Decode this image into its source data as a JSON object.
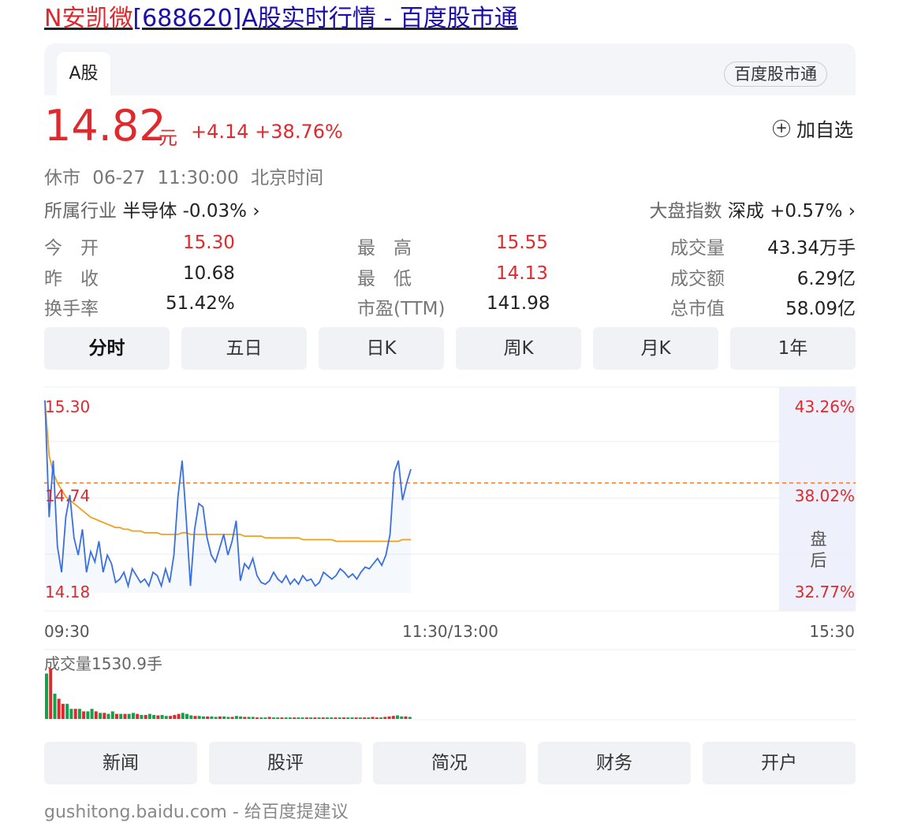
{
  "page_title": {
    "highlight": "N安凯微",
    "rest": "[688620]A股实时行情 - 百度股市通"
  },
  "tab": "A股",
  "badge": "百度股市通",
  "quote": {
    "price": "14.82",
    "unit": "元",
    "change": "+4.14 +38.76%",
    "add_label": "加自选",
    "status": "休市  06-27 11:30:00  北京时间",
    "industry_label": "所属行业",
    "industry_value": "半导体 -0.03%",
    "index_label": "大盘指数",
    "index_value": "深成 +0.57%"
  },
  "stats": [
    {
      "label": "今　开",
      "value": "15.30",
      "color": "red"
    },
    {
      "label": "最　高",
      "value": "15.55",
      "color": "red"
    },
    {
      "label": "成交量",
      "value": "43.34万手",
      "color": "black"
    },
    {
      "label": "昨　收",
      "value": "10.68",
      "color": "black"
    },
    {
      "label": "最　低",
      "value": "14.13",
      "color": "red"
    },
    {
      "label": "成交额",
      "value": "6.29亿",
      "color": "black"
    },
    {
      "label": "换手率",
      "value": "51.42%",
      "color": "black"
    },
    {
      "label": "市盈(TTM)",
      "value": "141.98",
      "color": "black"
    },
    {
      "label": "总市值",
      "value": "58.09亿",
      "color": "black"
    }
  ],
  "periods": [
    "分时",
    "五日",
    "日K",
    "周K",
    "月K",
    "1年"
  ],
  "chart_data": {
    "type": "line",
    "y_labels": [
      "15.30",
      "14.74",
      "14.18"
    ],
    "pct_labels": [
      "43.26%",
      "38.02%",
      "32.77%"
    ],
    "time_labels": [
      "09:30",
      "11:30/13:00",
      "15:30"
    ],
    "after_hours_label": [
      "盘",
      "后"
    ],
    "prev_close_ref": 14.82,
    "ylim": [
      14.18,
      15.3
    ],
    "price": [
      15.3,
      14.62,
      14.95,
      14.45,
      14.3,
      14.62,
      14.75,
      14.5,
      14.4,
      14.55,
      14.3,
      14.42,
      14.36,
      14.48,
      14.3,
      14.4,
      14.35,
      14.24,
      14.26,
      14.3,
      14.22,
      14.32,
      14.28,
      14.24,
      14.26,
      14.22,
      14.3,
      14.28,
      14.22,
      14.32,
      14.24,
      14.4,
      14.74,
      14.95,
      14.6,
      14.22,
      14.55,
      14.7,
      14.68,
      14.5,
      14.4,
      14.36,
      14.44,
      14.52,
      14.4,
      14.48,
      14.6,
      14.25,
      14.35,
      14.32,
      14.38,
      14.28,
      14.24,
      14.23,
      14.25,
      14.3,
      14.26,
      14.24,
      14.28,
      14.23,
      14.26,
      14.23,
      14.28,
      14.25,
      14.26,
      14.22,
      14.24,
      14.3,
      14.28,
      14.26,
      14.28,
      14.32,
      14.3,
      14.27,
      14.29,
      14.26,
      14.3,
      14.33,
      14.32,
      14.35,
      14.38,
      14.34,
      14.4,
      14.52,
      14.88,
      14.95,
      14.72,
      14.82,
      14.9
    ],
    "avg": [
      15.3,
      14.98,
      14.88,
      14.82,
      14.78,
      14.74,
      14.72,
      14.7,
      14.68,
      14.66,
      14.64,
      14.62,
      14.61,
      14.6,
      14.59,
      14.58,
      14.57,
      14.56,
      14.56,
      14.55,
      14.55,
      14.54,
      14.54,
      14.54,
      14.53,
      14.53,
      14.53,
      14.53,
      14.52,
      14.52,
      14.52,
      14.52,
      14.52,
      14.53,
      14.53,
      14.52,
      14.52,
      14.52,
      14.52,
      14.52,
      14.52,
      14.52,
      14.52,
      14.52,
      14.52,
      14.52,
      14.52,
      14.52,
      14.51,
      14.51,
      14.51,
      14.51,
      14.51,
      14.5,
      14.5,
      14.5,
      14.5,
      14.5,
      14.5,
      14.5,
      14.5,
      14.5,
      14.49,
      14.49,
      14.49,
      14.49,
      14.49,
      14.49,
      14.49,
      14.49,
      14.48,
      14.48,
      14.48,
      14.48,
      14.48,
      14.48,
      14.48,
      14.48,
      14.48,
      14.48,
      14.48,
      14.48,
      14.48,
      14.48,
      14.48,
      14.48,
      14.49,
      14.49,
      14.49
    ],
    "volume_label": "成交量1530.9手",
    "volume": [
      9,
      10,
      5,
      4,
      3,
      3,
      2,
      2,
      2,
      1.5,
      1.5,
      2,
      1.5,
      1.2,
      1.2,
      1,
      1.5,
      1,
      1,
      1,
      1,
      1.2,
      1,
      0.8,
      0.8,
      1,
      0.8,
      0.7,
      0.8,
      0.6,
      0.6,
      0.8,
      1,
      1.2,
      1,
      0.7,
      0.6,
      0.6,
      0.5,
      0.5,
      0.5,
      0.4,
      0.5,
      0.5,
      0.4,
      0.4,
      0.6,
      0.5,
      0.4,
      0.4,
      0.4,
      0.3,
      0.3,
      0.3,
      0.4,
      0.3,
      0.3,
      0.3,
      0.3,
      0.3,
      0.3,
      0.3,
      0.3,
      0.3,
      0.3,
      0.3,
      0.3,
      0.3,
      0.3,
      0.3,
      0.3,
      0.3,
      0.3,
      0.3,
      0.3,
      0.3,
      0.3,
      0.3,
      0.3,
      0.4,
      0.3,
      0.3,
      0.4,
      0.5,
      0.6,
      0.7,
      0.5,
      0.5,
      0.4
    ],
    "volume_up": [
      0,
      1,
      0,
      1,
      1,
      0,
      0,
      1,
      0,
      1,
      0,
      0,
      1,
      0,
      1,
      0,
      0,
      1,
      0,
      1,
      0,
      0,
      1,
      0,
      1,
      0,
      0,
      1,
      0,
      0,
      1,
      1,
      1,
      0,
      0,
      0,
      1,
      0,
      0,
      1,
      0,
      0,
      1,
      0,
      0,
      1,
      0,
      0,
      1,
      0,
      0,
      1,
      0,
      0,
      1,
      0,
      0,
      1,
      0,
      0,
      1,
      0,
      0,
      1,
      0,
      1,
      0,
      1,
      0,
      0,
      1,
      0,
      1,
      0,
      0,
      1,
      0,
      1,
      0,
      1,
      1,
      0,
      1,
      1,
      1,
      0,
      0,
      1,
      0
    ]
  },
  "bottom_tabs": [
    "新闻",
    "股评",
    "简况",
    "财务",
    "开户"
  ],
  "footer": "gushitong.baidu.com - 给百度提建议",
  "colors": {
    "up": "#e0292d",
    "down": "#14a14b",
    "line": "#3a6fe0",
    "avg": "#f0a020",
    "ref": "#f07c2a",
    "after_hours": "#eef1fb"
  }
}
